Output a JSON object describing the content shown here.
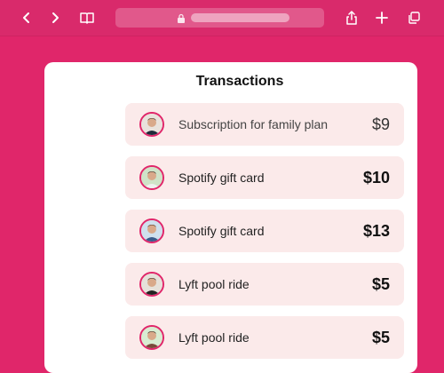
{
  "browser": {
    "back_icon": "chevron-left-icon",
    "forward_icon": "chevron-right-icon",
    "reader_icon": "book-icon",
    "lock_icon": "lock-icon",
    "share_icon": "share-icon",
    "new_tab_icon": "plus-icon",
    "tabs_icon": "tabs-icon"
  },
  "colors": {
    "accent": "#e0266a",
    "row_background": "#fbeaea"
  },
  "page": {
    "title": "Transactions"
  },
  "transactions": [
    {
      "label": "Subscription for family plan",
      "amount": "$9"
    },
    {
      "label": "Spotify gift card",
      "amount": "$10"
    },
    {
      "label": "Spotify gift card",
      "amount": "$13"
    },
    {
      "label": "Lyft pool ride",
      "amount": "$5"
    },
    {
      "label": "Lyft pool ride",
      "amount": "$5"
    }
  ]
}
